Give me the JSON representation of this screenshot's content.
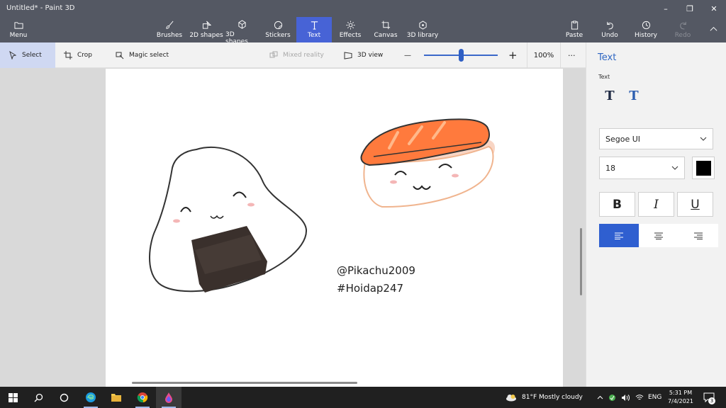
{
  "window": {
    "title": "Untitled* - Paint 3D",
    "minimize": "–",
    "maximize": "❐",
    "close": "✕"
  },
  "ribbon": {
    "menu": "Menu",
    "brushes": "Brushes",
    "shapes2d": "2D shapes",
    "shapes3d": "3D shapes",
    "stickers": "Stickers",
    "text": "Text",
    "effects": "Effects",
    "canvas": "Canvas",
    "library3d": "3D library",
    "paste": "Paste",
    "undo": "Undo",
    "history": "History",
    "redo": "Redo"
  },
  "toolbar": {
    "select": "Select",
    "crop": "Crop",
    "magic_select": "Magic select",
    "mixed_reality": "Mixed reality",
    "view3d": "3D view",
    "zoom_minus": "—",
    "zoom_plus": "+",
    "zoom_level": "100%",
    "zoom_fraction": 0.5,
    "more": "···"
  },
  "canvas": {
    "caption_line1": "@Pikachu2009",
    "caption_line2": "#Hoidap247"
  },
  "panel": {
    "title": "Text",
    "subtitle": "Text",
    "text_2d_glyph": "T",
    "text_3d_glyph": "T",
    "font": "Segoe UI",
    "font_size": "18",
    "color": "#000000",
    "bold": "B",
    "italic": "I",
    "underline": "U",
    "accent": "#2f5fd0"
  },
  "taskbar": {
    "weather": "81°F  Mostly cloudy",
    "language": "ENG",
    "time": "5:31 PM",
    "date": "7/4/2021",
    "notifications": "3"
  }
}
